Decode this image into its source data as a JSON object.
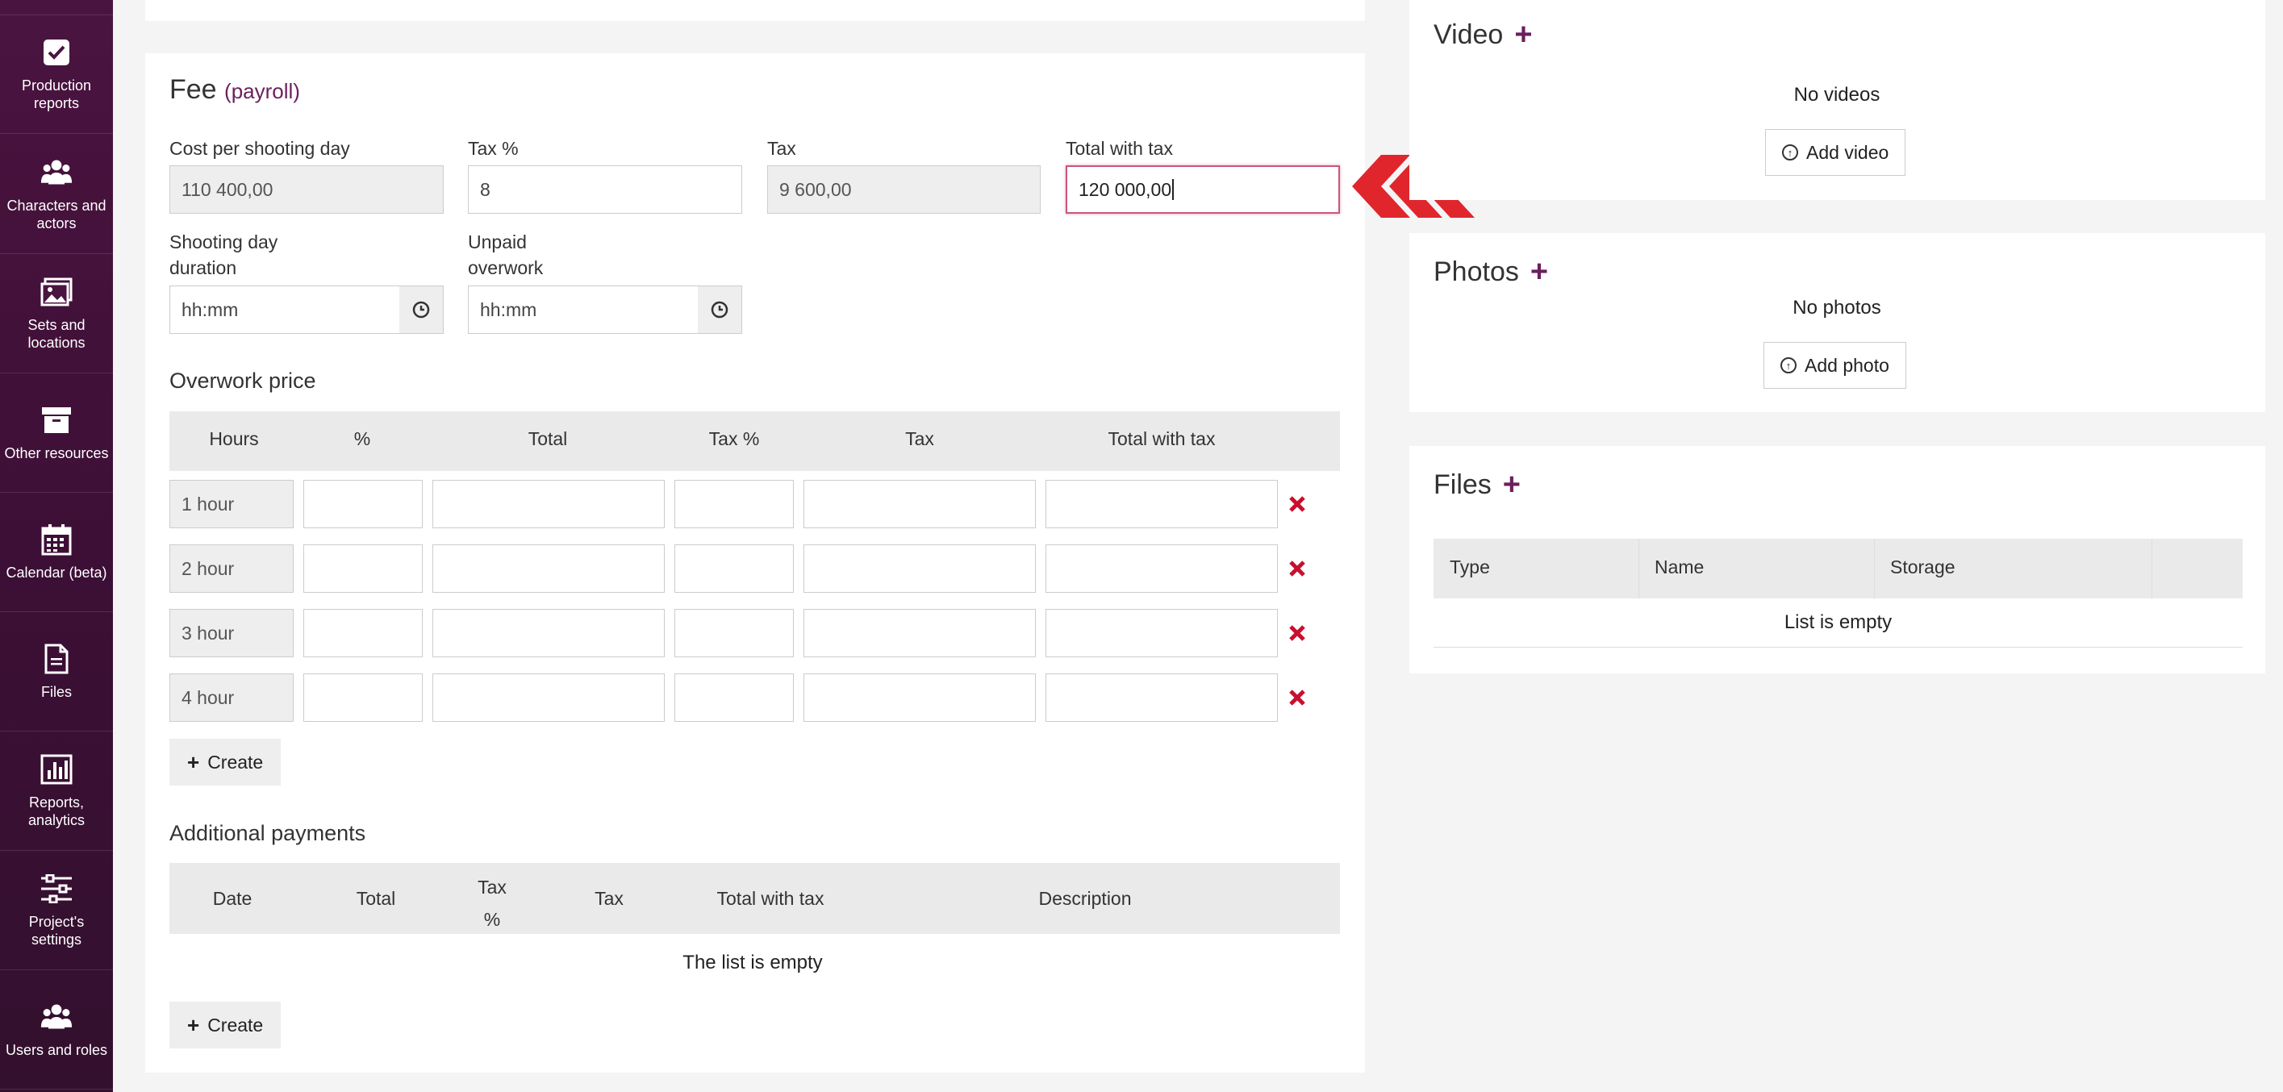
{
  "sidebar": {
    "items": [
      {
        "label": "Production reports",
        "icon": "checkbox-icon"
      },
      {
        "label": "Characters and actors",
        "icon": "users-icon"
      },
      {
        "label": "Sets and locations",
        "icon": "image-icon"
      },
      {
        "label": "Other resources",
        "icon": "archive-icon"
      },
      {
        "label": "Calendar (beta)",
        "icon": "calendar-icon"
      },
      {
        "label": "Files",
        "icon": "file-icon"
      },
      {
        "label": "Reports, analytics",
        "icon": "chart-icon"
      },
      {
        "label": "Project's settings",
        "icon": "sliders-icon"
      },
      {
        "label": "Users and roles",
        "icon": "users-icon"
      }
    ]
  },
  "fee": {
    "title": "Fee",
    "subtitle": "(payroll)",
    "cost_label": "Cost per shooting day",
    "cost_value": "110 400,00",
    "tax_pct_label": "Tax %",
    "tax_pct_value": "8",
    "tax_label": "Tax",
    "tax_value": "9 600,00",
    "total_label": "Total with tax",
    "total_value": "120 000,00",
    "duration_label_1": "Shooting day",
    "duration_label_2": "duration",
    "duration_placeholder": "hh:mm",
    "unpaid_label_1": "Unpaid",
    "unpaid_label_2": "overwork",
    "unpaid_placeholder": "hh:mm"
  },
  "overwork": {
    "title": "Overwork price",
    "columns": [
      "Hours",
      "%",
      "Total",
      "Tax %",
      "Tax",
      "Total with tax"
    ],
    "rows": [
      "1 hour",
      "2 hour",
      "3 hour",
      "4 hour"
    ],
    "create_label": "Create"
  },
  "additional": {
    "title": "Additional payments",
    "columns": [
      "Date",
      "Total",
      "Tax",
      "%",
      "Tax",
      "Total with tax",
      "Description"
    ],
    "empty": "The list is empty",
    "create_label": "Create"
  },
  "video": {
    "title": "Video",
    "empty": "No videos",
    "add_label": "Add video"
  },
  "photos": {
    "title": "Photos",
    "empty": "No photos",
    "add_label": "Add photo"
  },
  "files": {
    "title": "Files",
    "columns": [
      "Type",
      "Name",
      "Storage"
    ],
    "empty": "List is empty"
  },
  "colors": {
    "accent": "#6b1f5e",
    "pointer_arrow": "#e0262c",
    "delete": "#c8102e"
  }
}
